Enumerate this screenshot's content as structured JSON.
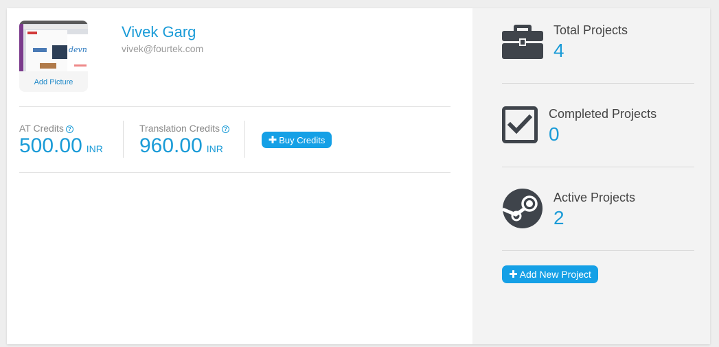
{
  "profile": {
    "add_picture_label": "Add Picture",
    "avatar_thumb_text": "devn",
    "name": "Vivek Garg",
    "email": "vivek@fourtek.com"
  },
  "credits": {
    "help_glyph": "?",
    "at": {
      "label": "AT Credits",
      "value": "500.00",
      "unit": "INR"
    },
    "translation": {
      "label": "Translation Credits",
      "value": "960.00",
      "unit": "INR"
    },
    "buy_button_label": "Buy Credits"
  },
  "stats": {
    "total": {
      "label": "Total Projects",
      "value": "4",
      "icon": "briefcase-icon"
    },
    "completed": {
      "label": "Completed Projects",
      "value": "0",
      "icon": "checkbox-icon"
    },
    "active": {
      "label": "Active Projects",
      "value": "2",
      "icon": "steam-icon"
    },
    "add_project_label": "Add New Project"
  },
  "colors": {
    "accent": "#1a9bd7",
    "button": "#15a0e6",
    "icon_dark": "#3f444b",
    "panel_bg": "#f3f3f3"
  }
}
